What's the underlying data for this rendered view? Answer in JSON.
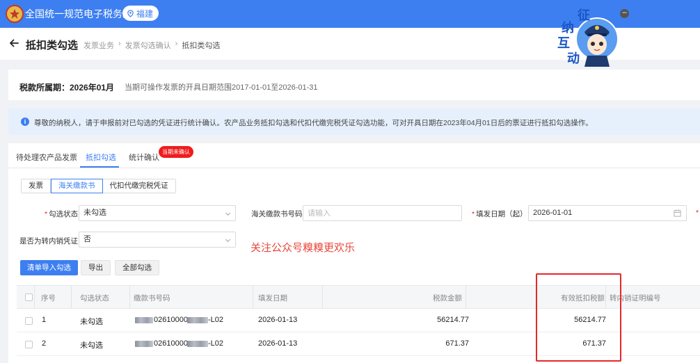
{
  "app": {
    "title": "全国统一规范电子税务局",
    "region": "福建"
  },
  "header": {
    "title": "抵扣类勾选",
    "breadcrumb": [
      "发票业务",
      "发票勾选确认",
      "抵扣类勾选"
    ]
  },
  "mascot": {
    "chars": [
      "征",
      "纳",
      "互",
      "动"
    ]
  },
  "period": {
    "label": "税款所属期：2026年01月",
    "hint": "当期可操作发票的开具日期范围2017-01-01至2026-01-31"
  },
  "notice": {
    "text": "尊敬的纳税人，请于申报前对已勾选的凭证进行统计确认。农产品业务抵扣勾选和代扣代缴完税凭证勾选功能，可对开具日期在2023年04月01日后的票证进行抵扣勾选操作。"
  },
  "tabs": [
    {
      "label": "待处理农产品发票"
    },
    {
      "label": "抵扣勾选"
    },
    {
      "label": "统计确认"
    }
  ],
  "tab_badge": "当期未确认",
  "segments": [
    "发票",
    "海关缴款书",
    "代扣代缴完税凭证"
  ],
  "filters": {
    "check_status": {
      "label": "勾选状态",
      "value": "未勾选"
    },
    "bill_no": {
      "label": "海关缴款书号码",
      "placeholder": "请输入"
    },
    "fill_date": {
      "label": "填发日期（起）",
      "value": "2026-01-01"
    },
    "transfer": {
      "label": "是否为转内销凭证",
      "value": "否"
    }
  },
  "watermark": "关注公众号糗糗更欢乐",
  "actions": {
    "import": "清单导入勾选",
    "export": "导出",
    "select_all": "全部勾选"
  },
  "table": {
    "columns": [
      "序号",
      "勾选状态",
      "缴款书号码",
      "填发日期",
      "税款金额",
      "有效抵扣税额",
      "转内销证明编号"
    ],
    "rows": [
      {
        "no": "1",
        "status": "未勾选",
        "bill_mid": "02610000",
        "bill_tail": "-L02",
        "date": "2026-01-13",
        "tax": "56214.77",
        "deduct": "56214.77"
      },
      {
        "no": "2",
        "status": "未勾选",
        "bill_mid": "02610000",
        "bill_tail": "-L02",
        "date": "2026-01-13",
        "tax": "671.37",
        "deduct": "671.37"
      }
    ]
  },
  "colors": {
    "primary": "#3d7ff0",
    "danger": "#e8262a",
    "badge": "#f01c1c"
  }
}
